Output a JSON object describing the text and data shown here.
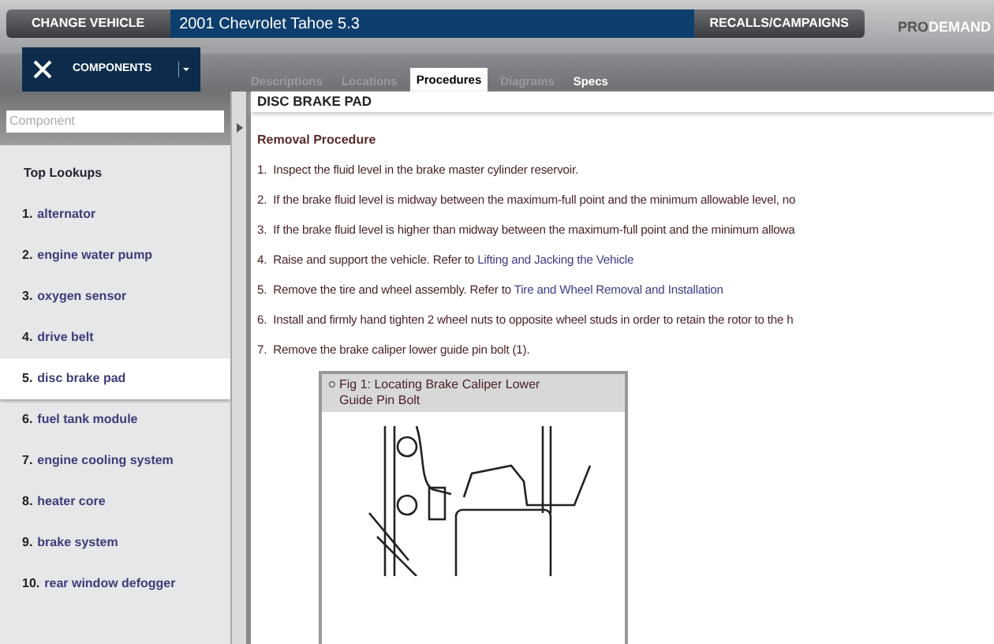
{
  "header": {
    "change_vehicle": "CHANGE VEHICLE",
    "vehicle": "2001 Chevrolet Tahoe 5.3",
    "recalls": "RECALLS/CAMPAIGNS",
    "brand_prefix": "PRO",
    "brand_suffix": "DEMAND"
  },
  "components_button": {
    "label": "COMPONENTS"
  },
  "tabs": [
    {
      "label": "Descriptions",
      "selected": false,
      "disabled": true
    },
    {
      "label": "Locations",
      "selected": false,
      "disabled": true
    },
    {
      "label": "Procedures",
      "selected": true,
      "disabled": false
    },
    {
      "label": "Diagrams",
      "selected": false,
      "disabled": true
    },
    {
      "label": "Specs",
      "selected": false,
      "disabled": false
    }
  ],
  "sidebar": {
    "search": {
      "placeholder": "Component"
    },
    "heading": "Top Lookups",
    "items": [
      {
        "number": "1.",
        "label": "alternator",
        "selected": false
      },
      {
        "number": "2.",
        "label": "engine water pump",
        "selected": false
      },
      {
        "number": "3.",
        "label": "oxygen sensor",
        "selected": false
      },
      {
        "number": "4.",
        "label": "drive belt",
        "selected": false
      },
      {
        "number": "5.",
        "label": "disc brake pad",
        "selected": true
      },
      {
        "number": "6.",
        "label": "fuel tank module",
        "selected": false
      },
      {
        "number": "7.",
        "label": "engine cooling system",
        "selected": false
      },
      {
        "number": "8.",
        "label": "heater core",
        "selected": false
      },
      {
        "number": "9.",
        "label": "brake system",
        "selected": false
      },
      {
        "number": "10.",
        "label": "rear window defogger",
        "selected": false
      }
    ]
  },
  "content": {
    "title": "DISC BRAKE PAD",
    "section": "Removal Procedure",
    "steps": [
      {
        "number": "1.",
        "text": "Inspect the fluid level in the brake master cylinder reservoir."
      },
      {
        "number": "2.",
        "text": "If the brake fluid level is midway between the maximum-full point and the minimum allowable level, no"
      },
      {
        "number": "3.",
        "text": "If the brake fluid level is higher than midway between the maximum-full point and the minimum allowa"
      },
      {
        "number": "4.",
        "text": "Raise and support the vehicle. Refer to",
        "link": "Lifting and Jacking the Vehicle"
      },
      {
        "number": "5.",
        "text": "Remove the tire and wheel assembly. Refer to",
        "link": "Tire and Wheel Removal and Installation"
      },
      {
        "number": "6.",
        "text": "Install and firmly hand tighten 2 wheel nuts to opposite wheel studs in order to retain the rotor to the h"
      },
      {
        "number": "7.",
        "text": "Remove the brake caliper lower guide pin bolt (1)."
      }
    ],
    "figure": {
      "caption": "Fig 1: Locating Brake Caliper Lower Guide Pin Bolt"
    }
  }
}
